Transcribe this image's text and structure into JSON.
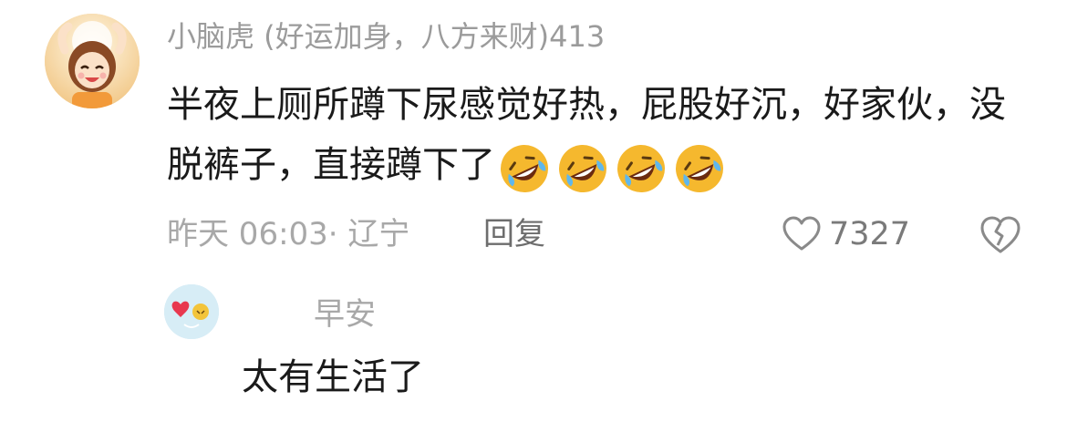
{
  "comment": {
    "username": "小脑虎 (好运加身，八方来财)413",
    "text": "半夜上厕所蹲下尿感觉好热，屁股好沉，好家伙，没脱裤子，直接蹲下了",
    "emojis": [
      "rolling-on-floor-laughing",
      "rolling-on-floor-laughing",
      "rolling-on-floor-laughing",
      "rolling-on-floor-laughing"
    ],
    "meta": "昨天 06:03· 辽宁",
    "reply_label": "回复",
    "like_count": "7327"
  },
  "reply": {
    "username": "早安",
    "text": "太有生活了"
  },
  "colors": {
    "text": "#1a1a1a",
    "muted": "#a8a8a8",
    "emoji_face": "#f5b82e"
  },
  "icons": {
    "like": "heart-outline-icon",
    "dislike": "broken-heart-outline-icon"
  }
}
